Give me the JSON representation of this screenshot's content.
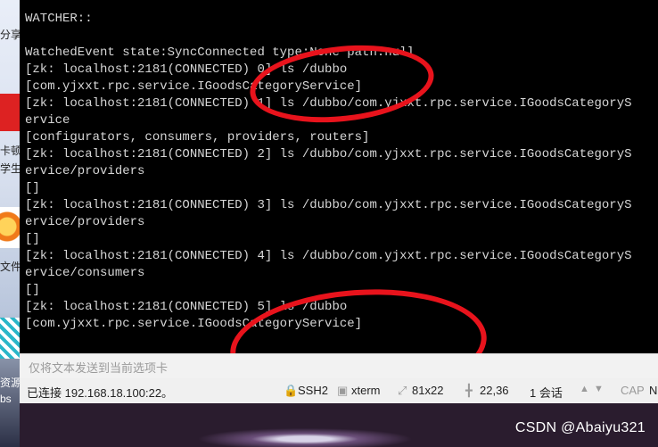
{
  "desktop_left": {
    "fragments": [
      "分享",
      "卡顿",
      "学生",
      "文件",
      "资源",
      "bs"
    ]
  },
  "terminal": {
    "lines": [
      "WATCHER::",
      "",
      "WatchedEvent state:SyncConnected type:None path:null",
      "[zk: localhost:2181(CONNECTED) 0] ls /dubbo",
      "[com.yjxxt.rpc.service.IGoodsCategoryService]",
      "[zk: localhost:2181(CONNECTED) 1] ls /dubbo/com.yjxxt.rpc.service.IGoodsCategoryS",
      "ervice",
      "[configurators, consumers, providers, routers]",
      "[zk: localhost:2181(CONNECTED) 2] ls /dubbo/com.yjxxt.rpc.service.IGoodsCategoryS",
      "ervice/providers",
      "[]",
      "[zk: localhost:2181(CONNECTED) 3] ls /dubbo/com.yjxxt.rpc.service.IGoodsCategoryS",
      "ervice/providers",
      "[]",
      "[zk: localhost:2181(CONNECTED) 4] ls /dubbo/com.yjxxt.rpc.service.IGoodsCategoryS",
      "ervice/consumers",
      "[]",
      "[zk: localhost:2181(CONNECTED) 5] ls /dubbo",
      "[com.yjxxt.rpc.service.IGoodsCategoryService]"
    ]
  },
  "input_bar": {
    "placeholder": "仅将文本发送到当前选项卡"
  },
  "status_bar": {
    "connection": "已连接 192.168.18.100:22。",
    "protocol": "SSH2",
    "terminal_type": "xterm",
    "size": "81x22",
    "cursor": "22,36",
    "sessions": "1 会话",
    "caps": "CAP",
    "num": "N"
  },
  "watermark": "CSDN @Abaiyu321",
  "colors": {
    "terminal_bg": "#000000",
    "terminal_fg": "#d6d6d6",
    "annotation": "#e8131c"
  }
}
